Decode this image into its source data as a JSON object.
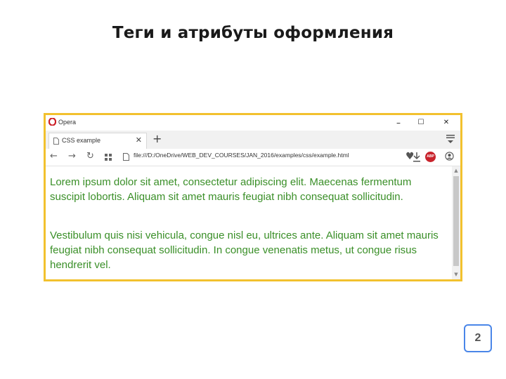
{
  "slide": {
    "title": "Теги и атрибуты оформления",
    "page_number": "2"
  },
  "browser": {
    "app_name": "Opera",
    "window_controls": {
      "minimize": "–",
      "maximize": "☐",
      "close": "✕"
    },
    "tab": {
      "label": "CSS example",
      "close": "✕"
    },
    "new_tab": "+",
    "nav": {
      "back": "←",
      "forward": "→",
      "reload": "↻"
    },
    "address": "file:///D:/OneDrive/WEB_DEV_COURSES/JAN_2016/examples/css/example.html",
    "adblock_label": "ABP",
    "brand_color": "#cc1d25",
    "frame_color": "#f2c12e"
  },
  "content": {
    "text_color": "#3a8f28",
    "paragraphs": [
      "Lorem ipsum dolor sit amet, consectetur adipiscing elit. Maecenas fermentum suscipit lobortis. Aliquam sit amet mauris feugiat nibh consequat sollicitudin.",
      "Vestibulum quis nisi vehicula, congue nisl eu, ultrices ante. Aliquam sit amet mauris feugiat nibh consequat sollicitudin. In congue venenatis metus, ut congue risus hendrerit vel."
    ]
  },
  "icons": [
    "opera-logo-icon",
    "page-icon",
    "tab-menu-icon",
    "speed-dial-icon",
    "heart-icon",
    "download-icon",
    "adblock-icon",
    "profile-icon"
  ]
}
